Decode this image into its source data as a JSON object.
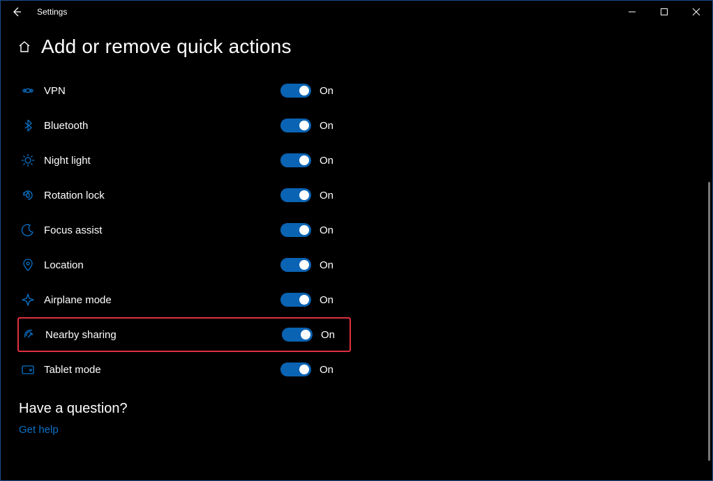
{
  "window": {
    "title": "Settings"
  },
  "page": {
    "title": "Add or remove quick actions"
  },
  "actions": [
    {
      "id": "vpn",
      "label": "VPN",
      "state": "On",
      "highlighted": false
    },
    {
      "id": "bluetooth",
      "label": "Bluetooth",
      "state": "On",
      "highlighted": false
    },
    {
      "id": "night-light",
      "label": "Night light",
      "state": "On",
      "highlighted": false
    },
    {
      "id": "rotation-lock",
      "label": "Rotation lock",
      "state": "On",
      "highlighted": false
    },
    {
      "id": "focus-assist",
      "label": "Focus assist",
      "state": "On",
      "highlighted": false
    },
    {
      "id": "location",
      "label": "Location",
      "state": "On",
      "highlighted": false
    },
    {
      "id": "airplane-mode",
      "label": "Airplane mode",
      "state": "On",
      "highlighted": false
    },
    {
      "id": "nearby-sharing",
      "label": "Nearby sharing",
      "state": "On",
      "highlighted": true
    },
    {
      "id": "tablet-mode",
      "label": "Tablet mode",
      "state": "On",
      "highlighted": false
    }
  ],
  "help": {
    "heading": "Have a question?",
    "link": "Get help"
  },
  "colors": {
    "accent": "#0a72c9",
    "toggle": "#0a63b3",
    "highlight_border": "#e03040"
  }
}
